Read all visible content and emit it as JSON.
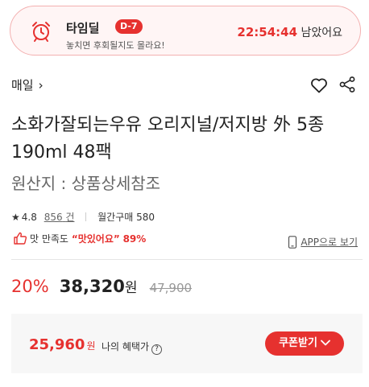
{
  "timedeal": {
    "title": "타임딜",
    "badge": "D-7",
    "subtitle": "놓치면 후회될지도 몰라요!",
    "time": "22:54:44",
    "time_suffix": " 남았어요"
  },
  "breadcrumb": {
    "label": "매일",
    "chevron": "›"
  },
  "product": {
    "title": "소화가잘되는우유 오리지널/저지방 外 5종 190ml 48팩",
    "origin": "원산지 : 상품상세참조"
  },
  "rating": {
    "star": "★",
    "score": "4.8",
    "review_count": "856",
    "review_unit": "건",
    "monthly_label": "월간구매",
    "monthly_count": "580"
  },
  "taste": {
    "label": "맛 만족도",
    "highlight": "“맛있어요”",
    "percent": "89%"
  },
  "app_link": "APP으로 보기",
  "price": {
    "discount": "20%",
    "sale": "38,320",
    "won": "원",
    "original": "47,900"
  },
  "coupon": {
    "price": "25,960",
    "won": "원",
    "benefit_label": "나의 혜택가",
    "help": "?",
    "button": "쿠폰받기",
    "button_chevron": "⌄"
  },
  "colors": {
    "accent": "#e6312f",
    "timedeal_bg": "#fff5f5",
    "timedeal_border": "#f3b0b0",
    "coupon_bg": "#f7f7f7"
  },
  "icons": [
    "alarm-clock-icon",
    "chevron-right-icon",
    "heart-icon",
    "share-icon",
    "star-icon",
    "thumbs-up-icon",
    "phone-icon",
    "help-circle-icon",
    "chevron-down-icon"
  ]
}
